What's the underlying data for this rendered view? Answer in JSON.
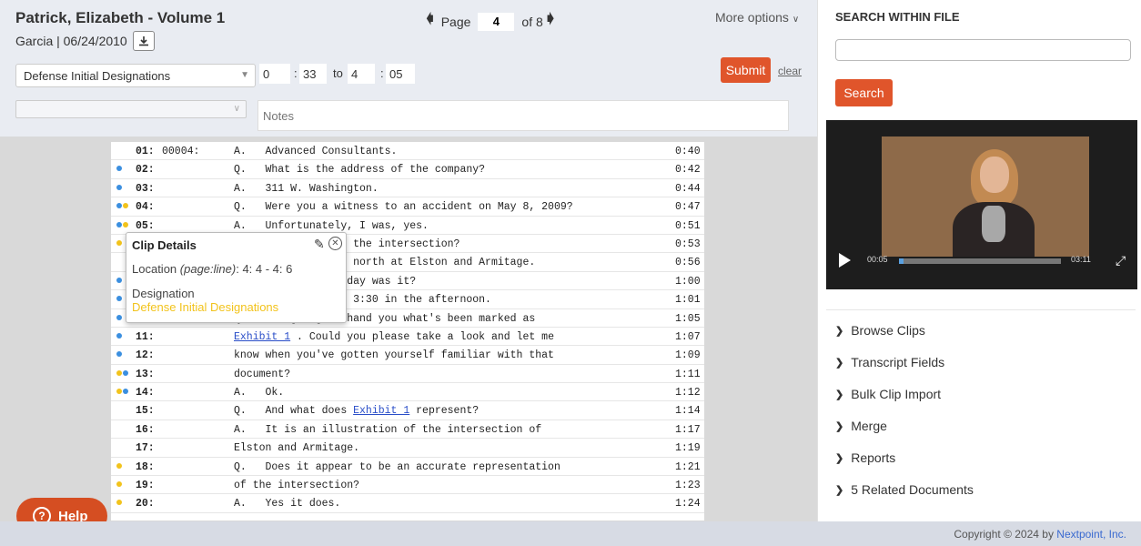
{
  "header": {
    "title": "Patrick, Elizabeth - Volume 1",
    "subtitle": "Garcia |  06/24/2010",
    "page_label": "Page",
    "page_value": "4",
    "page_of": "of 8",
    "more_options": "More options",
    "designation": "Defense Initial Designations",
    "start_page": "0",
    "start_line": "33",
    "to_label": "to",
    "end_page": "4",
    "end_line": "05",
    "submit": "Submit",
    "clear": "clear",
    "notes_placeholder": "Notes"
  },
  "transcript": [
    {
      "num": "01:",
      "bates": "00004:",
      "text": "A.   Advanced Consultants.",
      "ts": "0:40",
      "dots": []
    },
    {
      "num": "02:",
      "bates": "",
      "text": "Q.   What is the address of the company?",
      "ts": "0:42",
      "dots": [
        "blue"
      ]
    },
    {
      "num": "03:",
      "bates": "",
      "text": "A.   311 W. Washington.",
      "ts": "0:44",
      "dots": [
        "blue"
      ]
    },
    {
      "num": "04:",
      "bates": "",
      "text": "Q.   Were you a witness to an accident on May 8, 2009?",
      "ts": "0:47",
      "dots": [
        "blue",
        "yellow"
      ]
    },
    {
      "num": "05:",
      "bates": "",
      "text": "A.   Unfortunately, I was, yes.",
      "ts": "0:51",
      "dots": [
        "blue",
        "yellow"
      ]
    },
    {
      "num": "06:",
      "bates": "",
      "text": "Q.   Do you recall the intersection?",
      "ts": "0:53",
      "dots": [
        "yellow"
      ]
    },
    {
      "num": "07:",
      "bates": "",
      "text": "A.   I was driving north at Elston and Armitage.",
      "ts": "0:56",
      "dots": []
    },
    {
      "num": "08:",
      "bates": "",
      "text": "Q.   What time of day was it?",
      "ts": "1:00",
      "dots": [
        "blue"
      ]
    },
    {
      "num": "09:",
      "bates": "",
      "text": "A.   It was around 3:30 in the afternoon.",
      "ts": "1:01",
      "dots": [
        "blue"
      ]
    },
    {
      "num": "10:",
      "bates": "",
      "text": "Q.   I'm going to hand you what's been marked as",
      "ts": "1:05",
      "dots": [
        "blue"
      ]
    },
    {
      "num": "11:",
      "bates": "",
      "pre": "",
      "link": "Exhibit 1",
      "post": " . Could you please take a look and let me",
      "ts": "1:07",
      "dots": [
        "blue"
      ]
    },
    {
      "num": "12:",
      "bates": "",
      "text": "know when you've gotten yourself familiar with that",
      "ts": "1:09",
      "dots": [
        "blue"
      ]
    },
    {
      "num": "13:",
      "bates": "",
      "text": "document?",
      "ts": "1:11",
      "dots": [
        "yellow",
        "blue"
      ]
    },
    {
      "num": "14:",
      "bates": "",
      "text": "A.   Ok.",
      "ts": "1:12",
      "dots": [
        "yellow",
        "blue"
      ]
    },
    {
      "num": "15:",
      "bates": "",
      "pre": "Q.   And what does ",
      "link": "Exhibit 1",
      "post": " represent?",
      "ts": "1:14",
      "dots": []
    },
    {
      "num": "16:",
      "bates": "",
      "text": "A.   It is an illustration of the intersection of",
      "ts": "1:17",
      "dots": []
    },
    {
      "num": "17:",
      "bates": "",
      "text": "Elston and Armitage.",
      "ts": "1:19",
      "dots": []
    },
    {
      "num": "18:",
      "bates": "",
      "text": "Q.   Does it appear to be an accurate representation",
      "ts": "1:21",
      "dots": [
        "yellow"
      ]
    },
    {
      "num": "19:",
      "bates": "",
      "text": "of the intersection?",
      "ts": "1:23",
      "dots": [
        "yellow"
      ]
    },
    {
      "num": "20:",
      "bates": "",
      "text": "A.   Yes it does.",
      "ts": "1:24",
      "dots": [
        "yellow"
      ]
    }
  ],
  "clip": {
    "title": "Clip Details",
    "location_label": "Location",
    "location_hint": "(page:line)",
    "location_value": ": 4: 4 - 4: 6",
    "designation_label": "Designation",
    "designation_value": "Defense Initial Designations"
  },
  "help": "Help",
  "footer": {
    "copyright": "Copyright © 2024 by ",
    "company": "Nextpoint, Inc."
  },
  "sidebar": {
    "search_heading": "SEARCH WITHIN FILE",
    "search_button": "Search",
    "video": {
      "current": "00:05",
      "total": "03:11",
      "progress": 0.026
    },
    "items": [
      {
        "label": "Browse Clips"
      },
      {
        "label": "Transcript Fields"
      },
      {
        "label": "Bulk Clip Import"
      },
      {
        "label": "Merge"
      },
      {
        "label": "Reports"
      },
      {
        "label": "5 Related Documents"
      }
    ]
  },
  "colors": {
    "accent": "#e0552b",
    "blue_dot": "#3b8fe0",
    "yellow_dot": "#f2c31c",
    "link": "#2a4ec8"
  }
}
